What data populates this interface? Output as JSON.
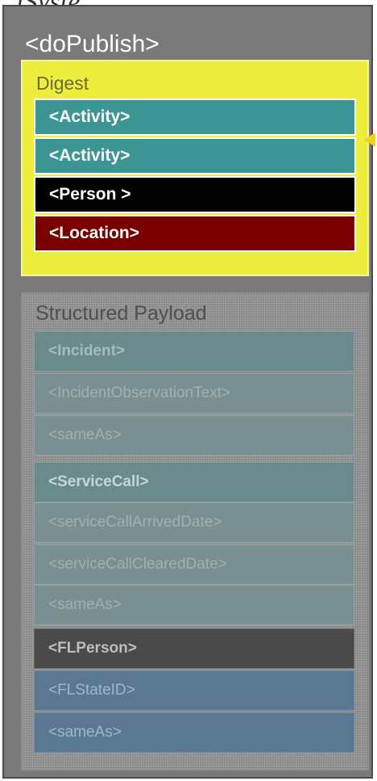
{
  "top_text": "lSyste",
  "container": {
    "title": "<doPublish>"
  },
  "digest": {
    "title": "Digest",
    "rows": [
      {
        "label": "<Activity>",
        "color": "#3d9696"
      },
      {
        "label": "<Activity>",
        "color": "#3d9696"
      },
      {
        "label": "<Person >",
        "color": "#000000"
      },
      {
        "label": "<Location>",
        "color": "#7a0000"
      }
    ],
    "arrow_color": "#f2d21c"
  },
  "payload": {
    "title": "Structured Payload",
    "rows": [
      {
        "label": "<Incident>",
        "color": "#6b8a8e",
        "text_color": "#a4bcbe",
        "bold": true
      },
      {
        "label": "<IncidentObservationText>",
        "color": "#7a8f91",
        "text_color": "#9fb0b2",
        "bold": false
      },
      {
        "label": "<sameAs>",
        "color": "#7a8f91",
        "text_color": "#9fb0b2",
        "bold": false
      },
      {
        "label": "<ServiceCall>",
        "color": "#6b8a8e",
        "text_color": "#c6d4d6",
        "bold": true
      },
      {
        "label": "<serviceCallArrivedDate>",
        "color": "#7a8f91",
        "text_color": "#9fb0b2",
        "bold": false
      },
      {
        "label": "<serviceCallClearedDate>",
        "color": "#7a8f91",
        "text_color": "#9fb0b2",
        "bold": false
      },
      {
        "label": "<sameAs>",
        "color": "#7a8f91",
        "text_color": "#9fb0b2",
        "bold": false
      },
      {
        "label": "<FLPerson>",
        "color": "#4a4a4a",
        "text_color": "#bdbdbd",
        "bold": true
      },
      {
        "label": "<FLStateID>",
        "color": "#5b7892",
        "text_color": "#9fb6c9",
        "bold": false
      },
      {
        "label": "<sameAs>",
        "color": "#5b7892",
        "text_color": "#9fb6c9",
        "bold": false
      }
    ]
  }
}
